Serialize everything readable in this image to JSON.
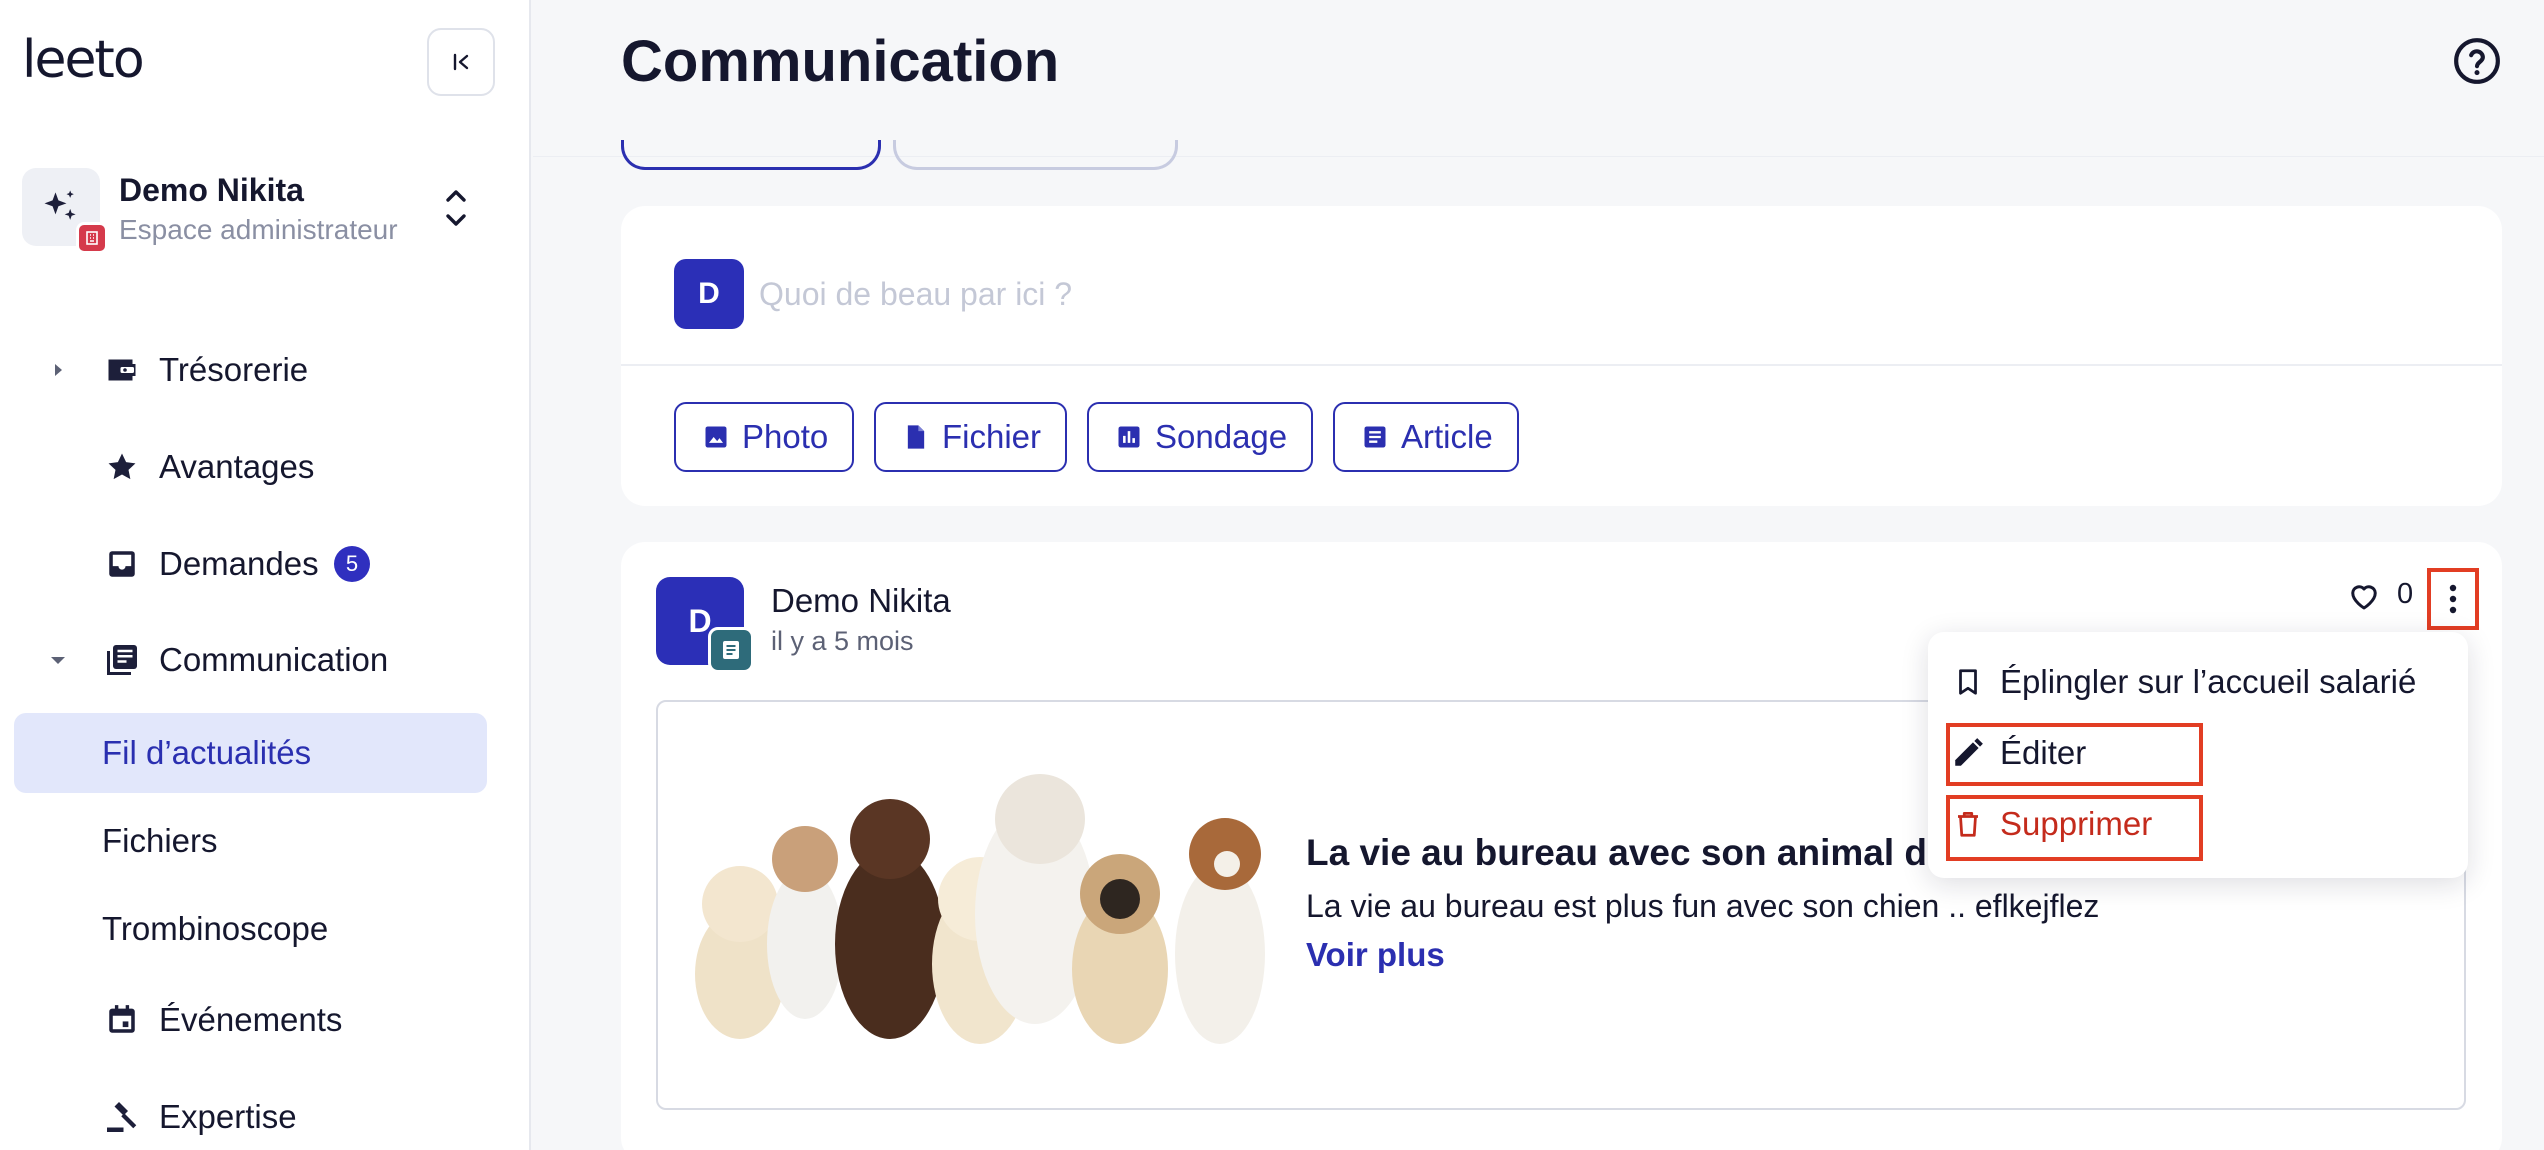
{
  "app": {
    "logo": "leeto"
  },
  "workspace": {
    "name": "Demo Nikita",
    "role": "Espace administrateur"
  },
  "sidebar": {
    "items": [
      {
        "label": "Trésorerie",
        "icon": "wallet-icon",
        "caret": "right"
      },
      {
        "label": "Avantages",
        "icon": "star-icon"
      },
      {
        "label": "Demandes",
        "icon": "inbox-icon",
        "badge": "5"
      },
      {
        "label": "Communication",
        "icon": "newspaper-icon",
        "caret": "down"
      }
    ],
    "sub_items": [
      {
        "label": "Fil d’actualités",
        "active": true
      },
      {
        "label": "Fichiers"
      },
      {
        "label": "Trombinoscope"
      }
    ],
    "more_items": [
      {
        "label": "Événements",
        "icon": "calendar-icon"
      },
      {
        "label": "Expertise",
        "icon": "gavel-icon"
      }
    ]
  },
  "header": {
    "title": "Communication"
  },
  "composer": {
    "avatar_initial": "D",
    "placeholder": "Quoi de beau par ici ?",
    "actions": [
      {
        "label": "Photo",
        "icon": "image-icon"
      },
      {
        "label": "Fichier",
        "icon": "file-icon"
      },
      {
        "label": "Sondage",
        "icon": "poll-icon"
      },
      {
        "label": "Article",
        "icon": "article-icon"
      }
    ]
  },
  "post": {
    "avatar_initial": "D",
    "author": "Demo Nikita",
    "time": "il y a 5 mois",
    "likes": "0",
    "article": {
      "title": "La vie au bureau avec son animal de c",
      "description": "La vie au bureau est plus fun avec son chien .. eflkejflez",
      "more_label": "Voir plus"
    }
  },
  "menu": {
    "pin_label": "Éplingler sur l’accueil salarié",
    "edit_label": "Éditer",
    "delete_label": "Supprimer"
  },
  "colors": {
    "accent": "#2b2fb0",
    "danger": "#c42b1c",
    "highlight": "#e23d23"
  }
}
